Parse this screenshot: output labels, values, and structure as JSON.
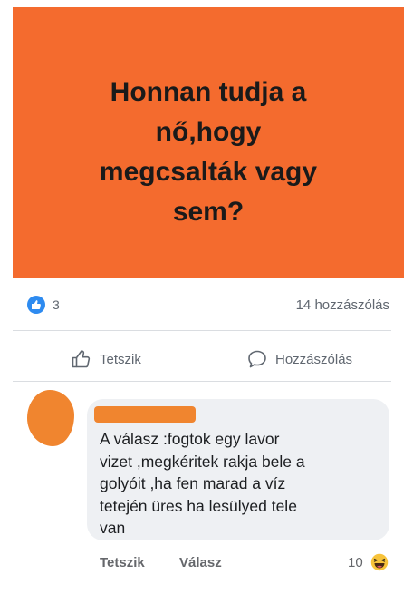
{
  "post": {
    "image_text": "Honnan tudja a\nnő,hogy\nmegcsalták vagy\nsem?"
  },
  "reactions": {
    "count": "3",
    "comments_label": "14 hozzászólás"
  },
  "actions": {
    "like_label": "Tetszik",
    "comment_label": "Hozzászólás"
  },
  "comment": {
    "author": "redacted",
    "text": "A válasz :fogtok egy lavor\nvizet ,megkéritek rakja bele a\ngolyóit ,ha fen marad a víz\ntetején üres ha lesülyed tele\nvan",
    "like_label": "Tetszik",
    "reply_label": "Válasz",
    "reaction_count": "10"
  },
  "colors": {
    "image_background": "#f46b2e",
    "redaction": "#f0852f",
    "like_blue": "#2e8bf0"
  }
}
